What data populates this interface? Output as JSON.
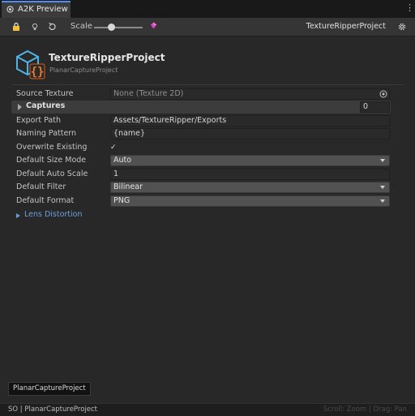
{
  "window": {
    "tab_label": "A2K Preview",
    "tab_icon": "eye-icon",
    "menu_icon": "kebab-menu-icon"
  },
  "toolbar": {
    "scale_label": "Scale",
    "scale_level": 0.35,
    "project_label": "TextureRipperProject",
    "icons": [
      "lock-icon",
      "lightbulb-icon",
      "undo-icon",
      "gem-icon",
      "gear-icon"
    ],
    "gem_color": "#e040c0"
  },
  "header": {
    "title": "TextureRipperProject",
    "subtitle": "PlanarCaptureProject",
    "icon": "cube-script-icon",
    "icon_colors": {
      "cube": "#4fb3e8",
      "braces": "#f07a2a"
    }
  },
  "properties": {
    "source_texture": {
      "label": "Source Texture",
      "value": "None (Texture 2D)"
    },
    "captures": {
      "label": "Captures",
      "count": "0"
    },
    "export_path": {
      "label": "Export Path",
      "value": "Assets/TextureRipper/Exports"
    },
    "naming_pattern": {
      "label": "Naming Pattern",
      "value": "{name}"
    },
    "overwrite_existing": {
      "label": "Overwrite Existing",
      "checked": true,
      "mark": "✓"
    },
    "default_size_mode": {
      "label": "Default Size Mode",
      "value": "Auto"
    },
    "default_auto_scale": {
      "label": "Default Auto Scale",
      "value": "1"
    },
    "default_filter": {
      "label": "Default Filter",
      "value": "Bilinear"
    },
    "default_format": {
      "label": "Default Format",
      "value": "PNG"
    },
    "lens_distortion": {
      "label": "Lens Distortion"
    }
  },
  "tooltip": {
    "text": "PlanarCaptureProject"
  },
  "statusbar": {
    "left": "SO | PlanarCaptureProject",
    "right": "Scroll: Zoom | Drag: Pan"
  },
  "colors": {
    "accent": "#4d8ef0",
    "link": "#6d9fe0",
    "background": "#282828"
  }
}
